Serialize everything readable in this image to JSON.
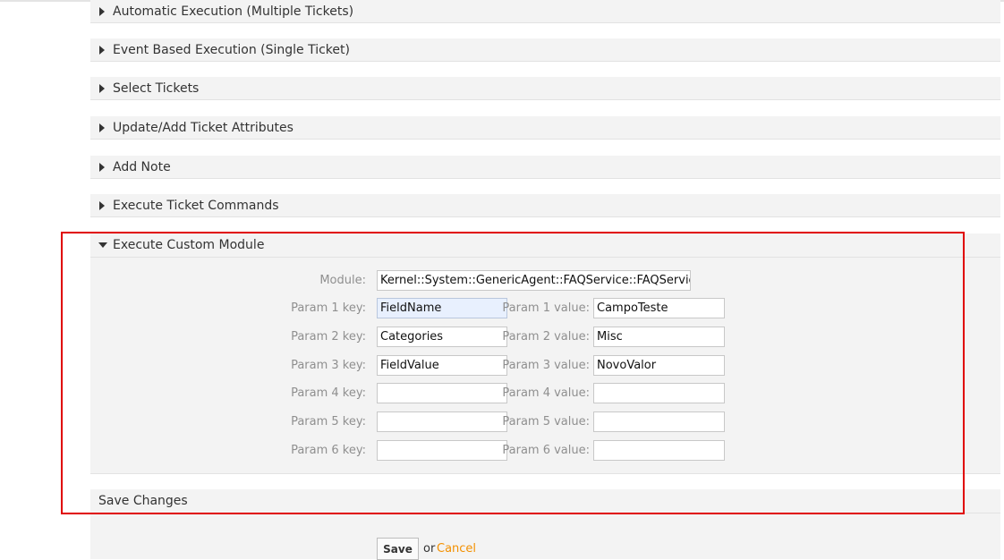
{
  "sections": {
    "automatic_execution": "Automatic Execution (Multiple Tickets)",
    "event_based_execution": "Event Based Execution (Single Ticket)",
    "select_tickets": "Select Tickets",
    "update_ticket_attributes": "Update/Add Ticket Attributes",
    "add_note": "Add Note",
    "execute_ticket_commands": "Execute Ticket Commands",
    "execute_custom_module": "Execute Custom Module"
  },
  "module": {
    "label": "Module:",
    "value": "Kernel::System::GenericAgent::FAQService::FAQServiceS"
  },
  "params": [
    {
      "key_label": "Param 1 key:",
      "key": "FieldName",
      "value_label": "Param 1 value:",
      "value": "CampoTeste"
    },
    {
      "key_label": "Param 2 key:",
      "key": "Categories",
      "value_label": "Param 2 value:",
      "value": "Misc"
    },
    {
      "key_label": "Param 3 key:",
      "key": "FieldValue",
      "value_label": "Param 3 value:",
      "value": "NovoValor"
    },
    {
      "key_label": "Param 4 key:",
      "key": "",
      "value_label": "Param 4 value:",
      "value": ""
    },
    {
      "key_label": "Param 5 key:",
      "key": "",
      "value_label": "Param 5 value:",
      "value": ""
    },
    {
      "key_label": "Param 6 key:",
      "key": "",
      "value_label": "Param 6 value:",
      "value": ""
    }
  ],
  "save_section": {
    "title": "Save Changes",
    "save_label": "Save",
    "or_text": "or",
    "cancel_label": "Cancel"
  },
  "colors": {
    "highlight": "#e00000",
    "cancel_link": "#f39000",
    "section_bg": "#f3f3f3"
  }
}
